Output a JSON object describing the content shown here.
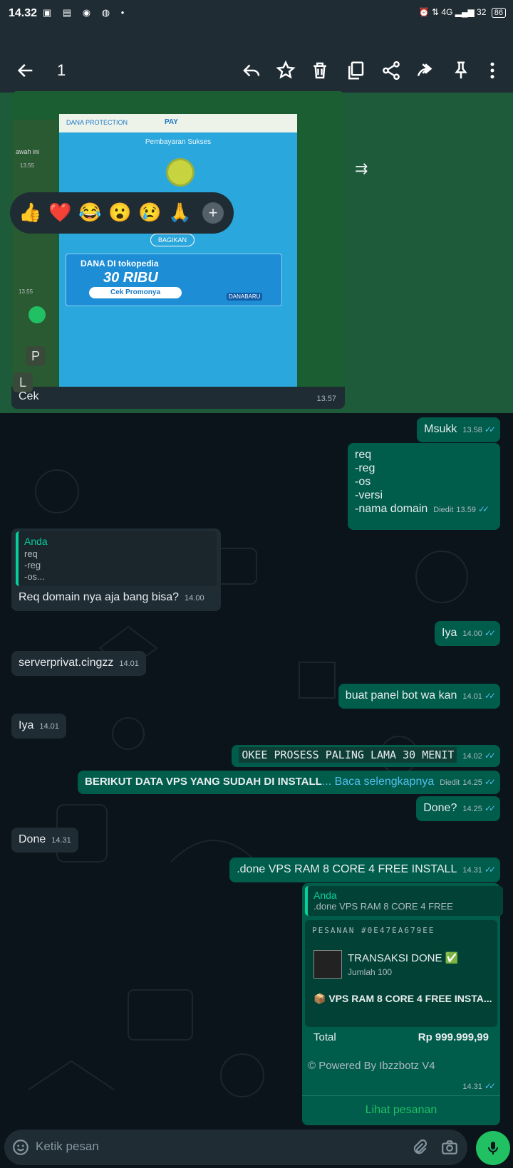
{
  "status": {
    "time": "14.32",
    "battery": "86",
    "network": "4G",
    "speed": "32"
  },
  "header": {
    "selected_count": "1"
  },
  "image_message": {
    "caption": "Cek",
    "time": "13.57",
    "screenshot": {
      "brand": "DANA PROTECTION",
      "pay": "PAY",
      "status": "Pembayaran Sukses",
      "share": "BAGIKAN",
      "promo_title": "DANA DI tokopedia",
      "promo_amount": "30 RIBU",
      "promo_button": "Cek Promonya",
      "promo_code": "DANABARU",
      "left_snippets": [
        "awah ini",
        "13.55",
        "13.55",
        "P",
        "L"
      ]
    }
  },
  "reactions": [
    "👍",
    "❤️",
    "😂",
    "😮",
    "😢",
    "🙏"
  ],
  "messages": {
    "m1": {
      "text": "Msukk",
      "time": "13.58"
    },
    "m2": {
      "lines": [
        "req",
        "-reg",
        "-os",
        "-versi",
        "-nama domain"
      ],
      "edited": "Diedit",
      "time": "13.59"
    },
    "m3": {
      "quote_author": "Anda",
      "quote_lines": [
        "req",
        "-reg",
        "-os..."
      ],
      "text": "Req domain nya aja bang bisa?",
      "time": "14.00"
    },
    "m4": {
      "text": "Iya",
      "time": "14.00"
    },
    "m5": {
      "text": "serverprivat.cingzz",
      "time": "14.01"
    },
    "m6": {
      "text": "buat panel bot wa kan",
      "time": "14.01"
    },
    "m7": {
      "text": "Iya",
      "time": "14.01"
    },
    "m8": {
      "text": "OKEE PROSESS PALING LAMA 30 MENIT",
      "time": "14.02"
    },
    "m9": {
      "text": "BERIKUT DATA VPS YANG SUDAH DI INSTALL",
      "more": "... Baca selengkapnya",
      "edited": "Diedit",
      "time": "14.25"
    },
    "m10": {
      "text": "Done?",
      "time": "14.25"
    },
    "m11": {
      "text": "Done",
      "time": "14.31"
    },
    "m12": {
      "text": ".done VPS RAM 8 CORE 4 FREE INSTALL",
      "time": "14.31"
    }
  },
  "order": {
    "quote_author": "Anda",
    "quote_text": ".done VPS RAM 8 CORE 4 FREE",
    "label": "PESANAN #0E47EA679EE",
    "title": "TRANSAKSI DONE ✅",
    "quantity": "Jumlah 100",
    "item": "📦 VPS RAM 8 CORE 4 FREE INSTA...",
    "total_label": "Total",
    "total_value": "Rp 999.999,99",
    "powered": "© Powered By Ibzzbotz V4",
    "time": "14.31",
    "link": "Lihat pesanan"
  },
  "input": {
    "placeholder": "Ketik pesan"
  }
}
